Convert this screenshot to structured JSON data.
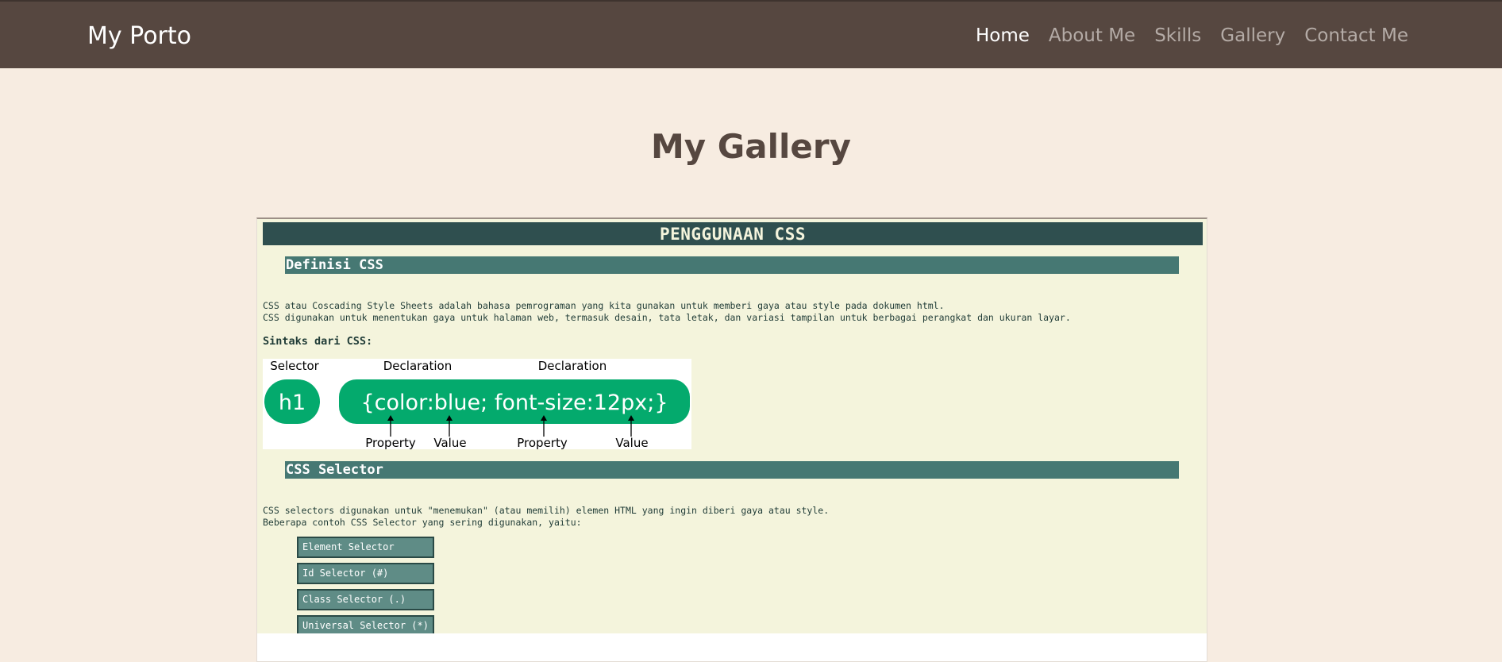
{
  "navbar": {
    "brand": "My Porto",
    "links": [
      {
        "label": "Home",
        "active": true
      },
      {
        "label": "About Me",
        "active": false
      },
      {
        "label": "Skills",
        "active": false
      },
      {
        "label": "Gallery",
        "active": false
      },
      {
        "label": "Contact Me",
        "active": false
      }
    ]
  },
  "main": {
    "title": "My Gallery"
  },
  "frame": {
    "header": "PENGGUNAAN CSS",
    "section1": {
      "title": "Definisi CSS",
      "lines": [
        "CSS atau Coscading Style Sheets adalah bahasa pemrograman yang kita gunakan untuk memberi gaya atau style pada dokumen html.",
        "CSS digunakan untuk menentukan gaya untuk halaman web, termasuk desain, tata letak, dan variasi tampilan untuk berbagai perangkat dan ukuran layar."
      ],
      "syntax_title": "Sintaks dari CSS:"
    },
    "diagram": {
      "selector_label": "Selector",
      "declaration_label_1": "Declaration",
      "declaration_label_2": "Declaration",
      "selector_text": "h1",
      "declaration_text": "{color:blue; font-size:12px;}",
      "property_1": "Property",
      "value_1": "Value",
      "property_2": "Property",
      "value_2": "Value",
      "pill_color": "#04aa6d"
    },
    "section2": {
      "title": "CSS Selector",
      "lines": [
        "CSS selectors digunakan untuk \"menemukan\" (atau memilih) elemen HTML yang ingin diberi gaya atau style.",
        "Beberapa contoh CSS Selector yang sering digunakan, yaitu:"
      ],
      "selectors": [
        "Element Selector",
        "Id Selector (#)",
        "Class Selector (.)",
        "Universal Selector (*)"
      ]
    }
  },
  "colors": {
    "navbar_bg": "#564740",
    "page_bg": "#f7ece1",
    "doc_header_bg": "#2f4f4f",
    "section_bar_bg": "#467873",
    "frame_bg": "#f4f4dc",
    "selector_box_bg": "#5f8c86"
  }
}
